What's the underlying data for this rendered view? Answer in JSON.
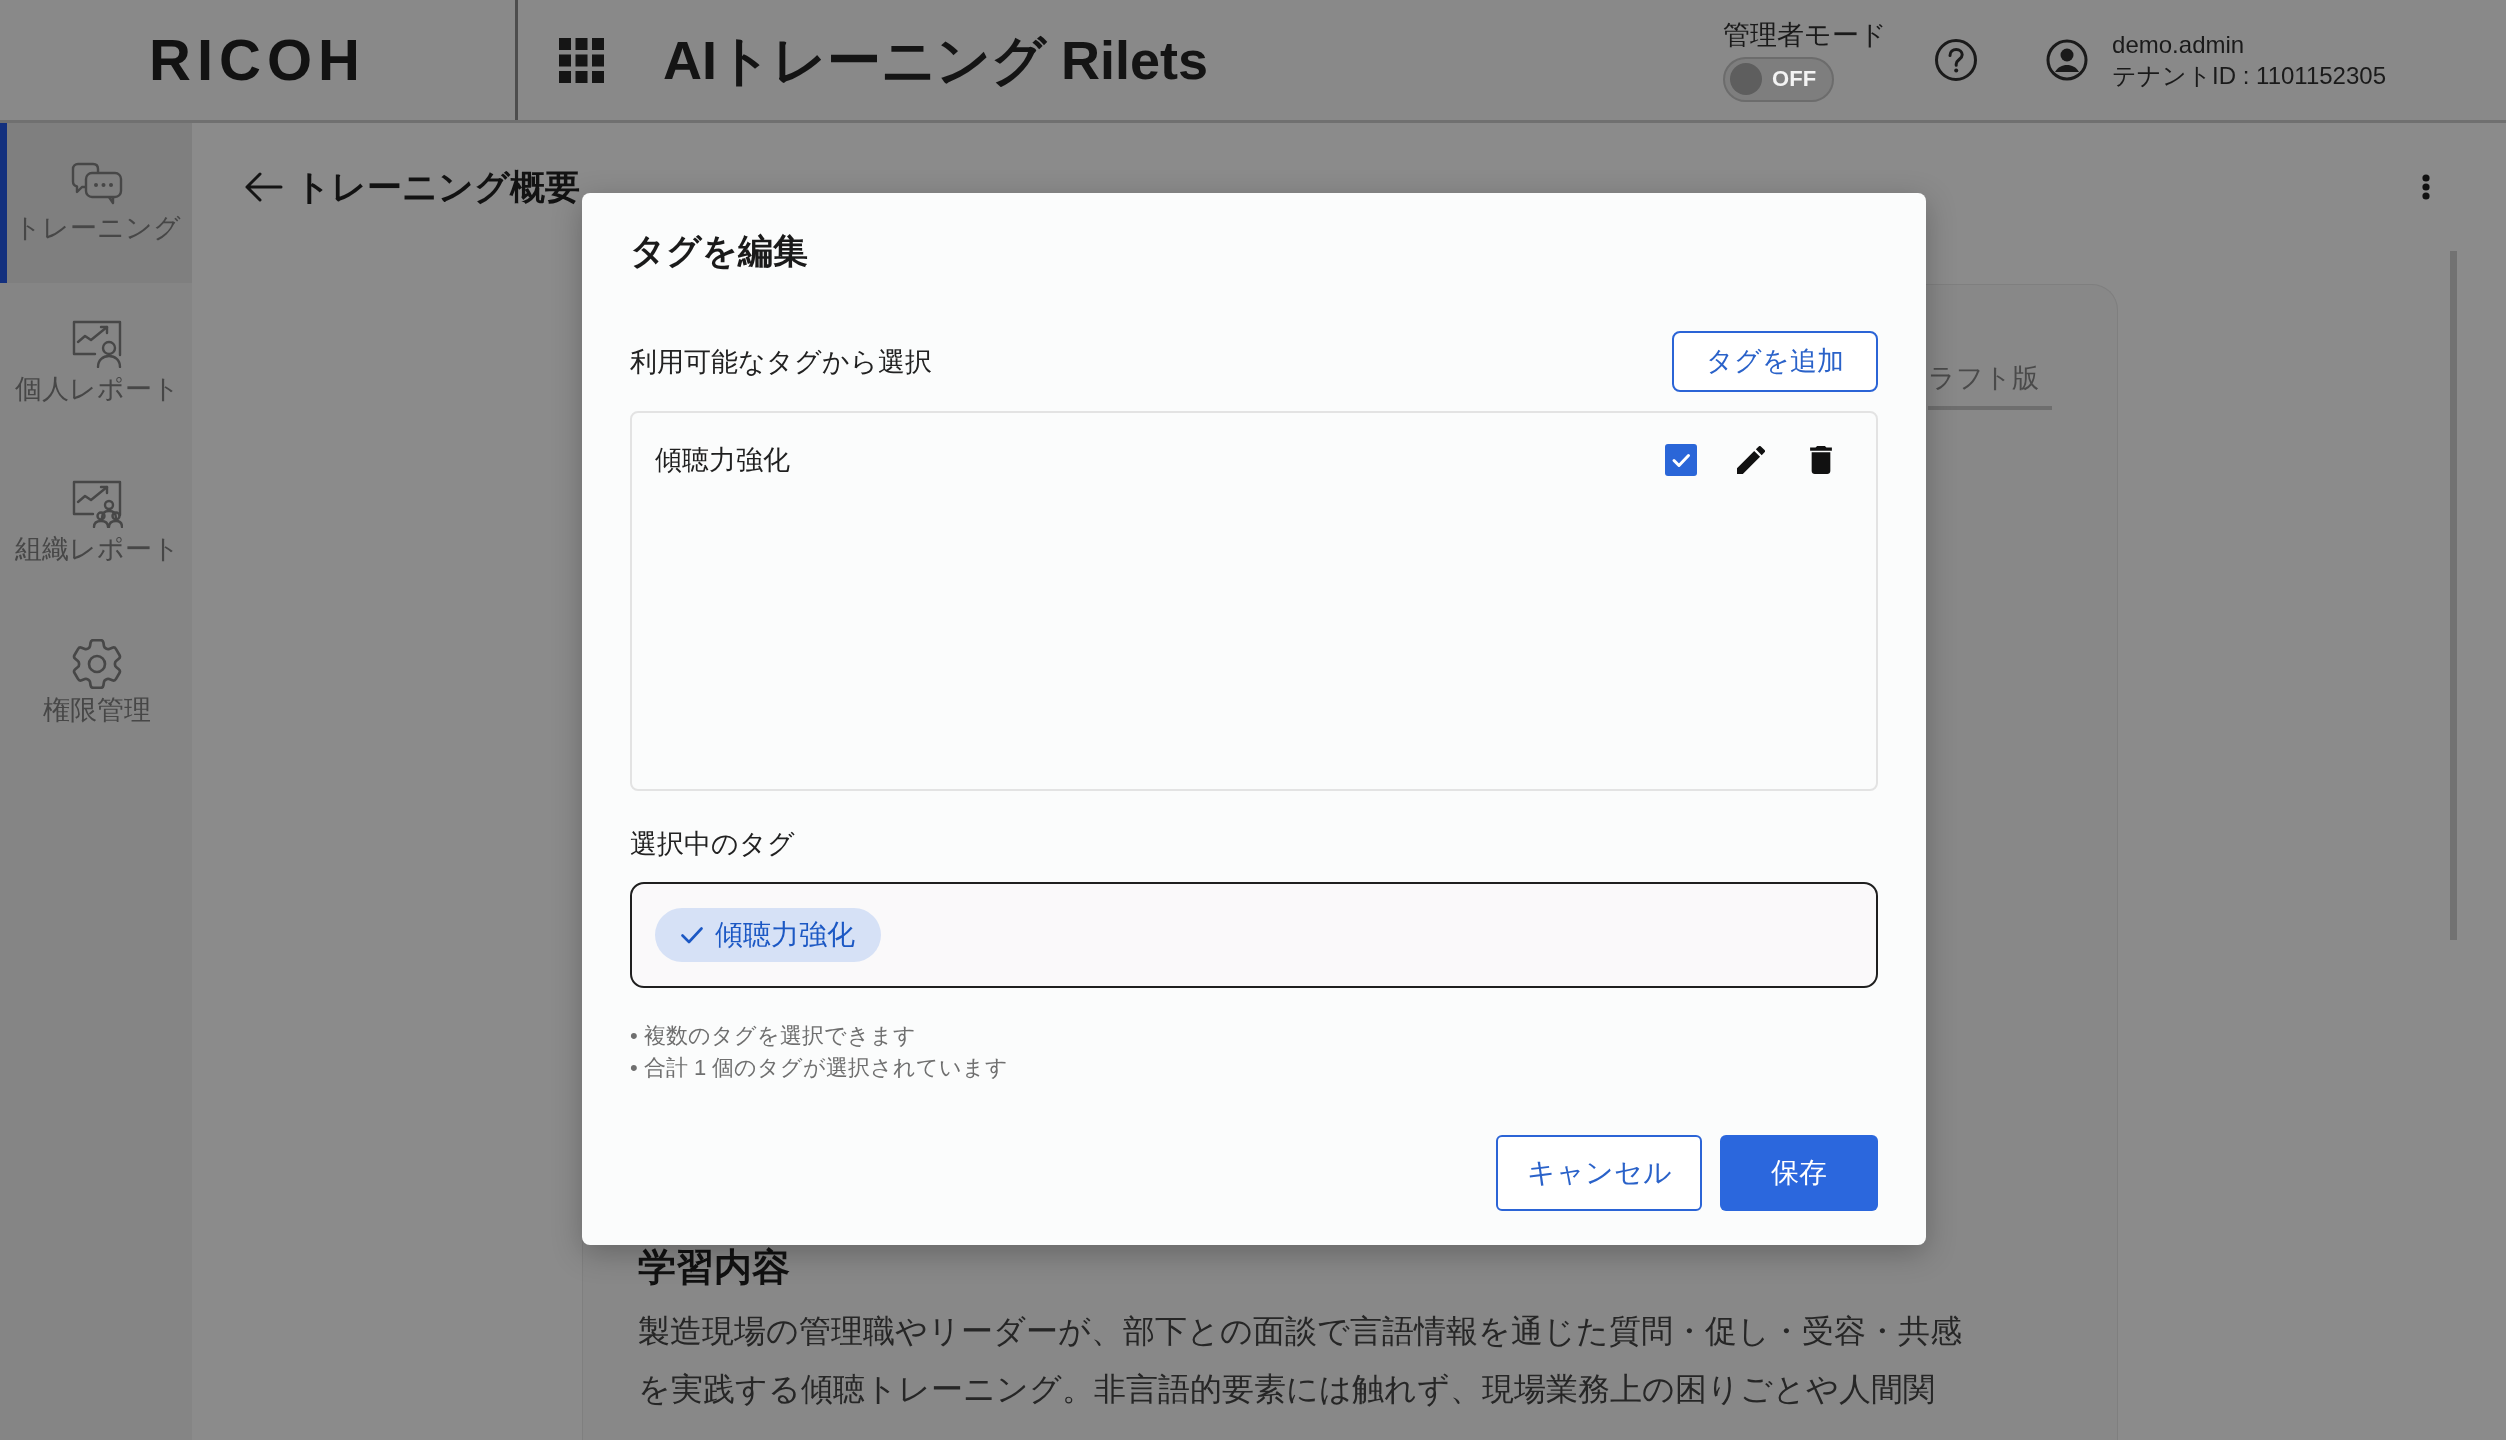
{
  "header": {
    "logo": "RICOH",
    "app_title": "AIトレーニング Rilets",
    "admin_mode": {
      "label": "管理者モード",
      "on": false,
      "text": "OFF"
    },
    "user": {
      "name": "demo.admin",
      "tenant": "テナントID : 1101152305"
    }
  },
  "sidebar": {
    "items": [
      {
        "label": "トレーニング",
        "selected": true
      },
      {
        "label": "個人レポート",
        "selected": false
      },
      {
        "label": "組織レポート",
        "selected": false
      },
      {
        "label": "権限管理",
        "selected": false
      }
    ]
  },
  "page": {
    "title": "トレーニング概要",
    "tabs": [
      {
        "label": "ラフト版",
        "selected": true
      }
    ],
    "section_heading": "学習内容",
    "section_text": "製造現場の管理職やリーダーが、部下との面談で言語情報を通じた質問・促し・受容・共感を実践する傾聴トレーニング。非言語的要素には触れず、現場業務上の困りごとや人間関"
  },
  "dialog": {
    "title": "タグを編集",
    "available_label": "利用可能なタグから選択",
    "add_button": "タグを追加",
    "available_tags": [
      {
        "label": "傾聴力強化",
        "checked": true
      }
    ],
    "selected_label": "選択中のタグ",
    "selected_tags": [
      {
        "label": "傾聴力強化"
      }
    ],
    "hints": [
      "• 複数のタグを選択できます",
      "• 合計 1 個のタグが選択されています"
    ],
    "buttons": [
      {
        "label": "キャンセル",
        "kind": "secondary"
      },
      {
        "label": "保存",
        "kind": "primary"
      }
    ]
  }
}
